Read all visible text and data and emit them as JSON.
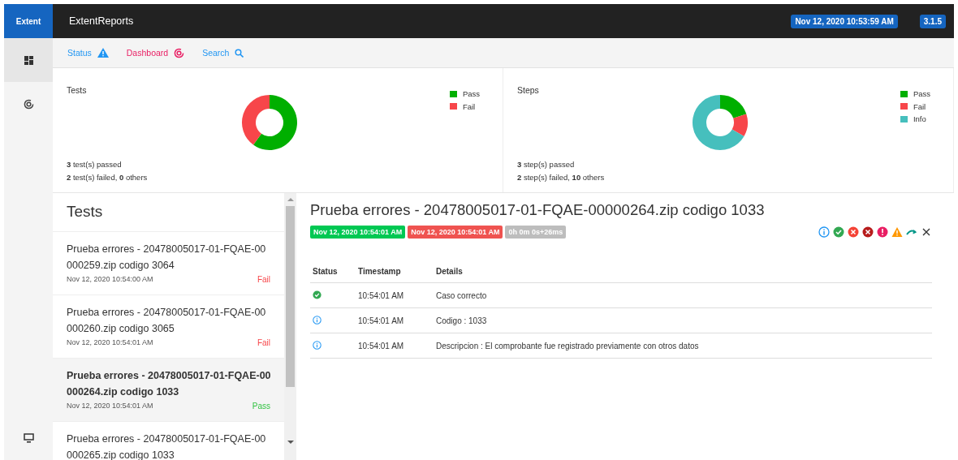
{
  "topbar": {
    "logo": "Extent",
    "title": "ExtentReports",
    "timestamp": "Nov 12, 2020 10:53:59 AM",
    "version": "3.1.5"
  },
  "sidebar": {
    "items": [
      {
        "kind": "dashboard",
        "selected": true
      },
      {
        "kind": "chart",
        "selected": false
      },
      {
        "kind": "monitor",
        "selected": false
      }
    ]
  },
  "nav": [
    {
      "label": "Status",
      "kind": "status"
    },
    {
      "label": "Dashboard",
      "kind": "dashboard"
    },
    {
      "label": "Search",
      "kind": "search"
    }
  ],
  "charts": [
    {
      "title": "Tests",
      "chart_data": {
        "type": "donut",
        "categories": [
          "Pass",
          "Fail"
        ],
        "values": [
          60,
          40
        ],
        "colors": [
          "#00af00",
          "#f7464a"
        ]
      },
      "summary": [
        "**3** test(s) passed",
        "**2** test(s) failed, **0** others"
      ]
    },
    {
      "title": "Steps",
      "chart_data": {
        "type": "donut",
        "categories": [
          "Pass",
          "Fail",
          "Info"
        ],
        "values": [
          20,
          13.3,
          66.7
        ],
        "colors": [
          "#00af00",
          "#f7464a",
          "#46bfbd"
        ]
      },
      "summary": [
        "**3** step(s) passed",
        "**2** step(s) failed, **10** others"
      ]
    }
  ],
  "tests": {
    "heading": "Tests",
    "items": [
      {
        "name": "Prueba errores - 20478005017-01-FQAE-00000259.zip codigo 3064",
        "time": "Nov 12, 2020 10:54:00 AM",
        "status": "Fail",
        "kind": "fail",
        "selected": false
      },
      {
        "name": "Prueba errores - 20478005017-01-FQAE-00000260.zip codigo 3065",
        "time": "Nov 12, 2020 10:54:01 AM",
        "status": "Fail",
        "kind": "fail",
        "selected": false
      },
      {
        "name": "Prueba errores - 20478005017-01-FQAE-00000264.zip codigo 1033",
        "time": "Nov 12, 2020 10:54:01 AM",
        "status": "Pass",
        "kind": "pass",
        "selected": true
      },
      {
        "name": "Prueba errores - 20478005017-01-FQAE-00000265.zip codigo 1033",
        "selected": false
      }
    ]
  },
  "detail": {
    "title": "Prueba errores - 20478005017-01-FQAE-00000264.zip codigo 1033",
    "start": "Nov 12, 2020 10:54:01 AM",
    "end": "Nov 12, 2020 10:54:01 AM",
    "duration": "0h 0m 0s+26ms",
    "filters": [
      {
        "kind": "info"
      },
      {
        "kind": "pass"
      },
      {
        "kind": "fail"
      },
      {
        "kind": "fatal"
      },
      {
        "kind": "error"
      },
      {
        "kind": "warning"
      },
      {
        "kind": "skip"
      },
      {
        "kind": "clear"
      }
    ],
    "columns": [
      "Status",
      "Timestamp",
      "Details"
    ],
    "rows": [
      {
        "kind": "pass",
        "timestamp": "10:54:01 AM",
        "details": "Caso correcto"
      },
      {
        "kind": "info",
        "timestamp": "10:54:01 AM",
        "details": "Codigo : 1033"
      },
      {
        "kind": "info",
        "timestamp": "10:54:01 AM",
        "details": "Descripcion : El comprobante fue registrado previamente con otros datos"
      }
    ]
  }
}
